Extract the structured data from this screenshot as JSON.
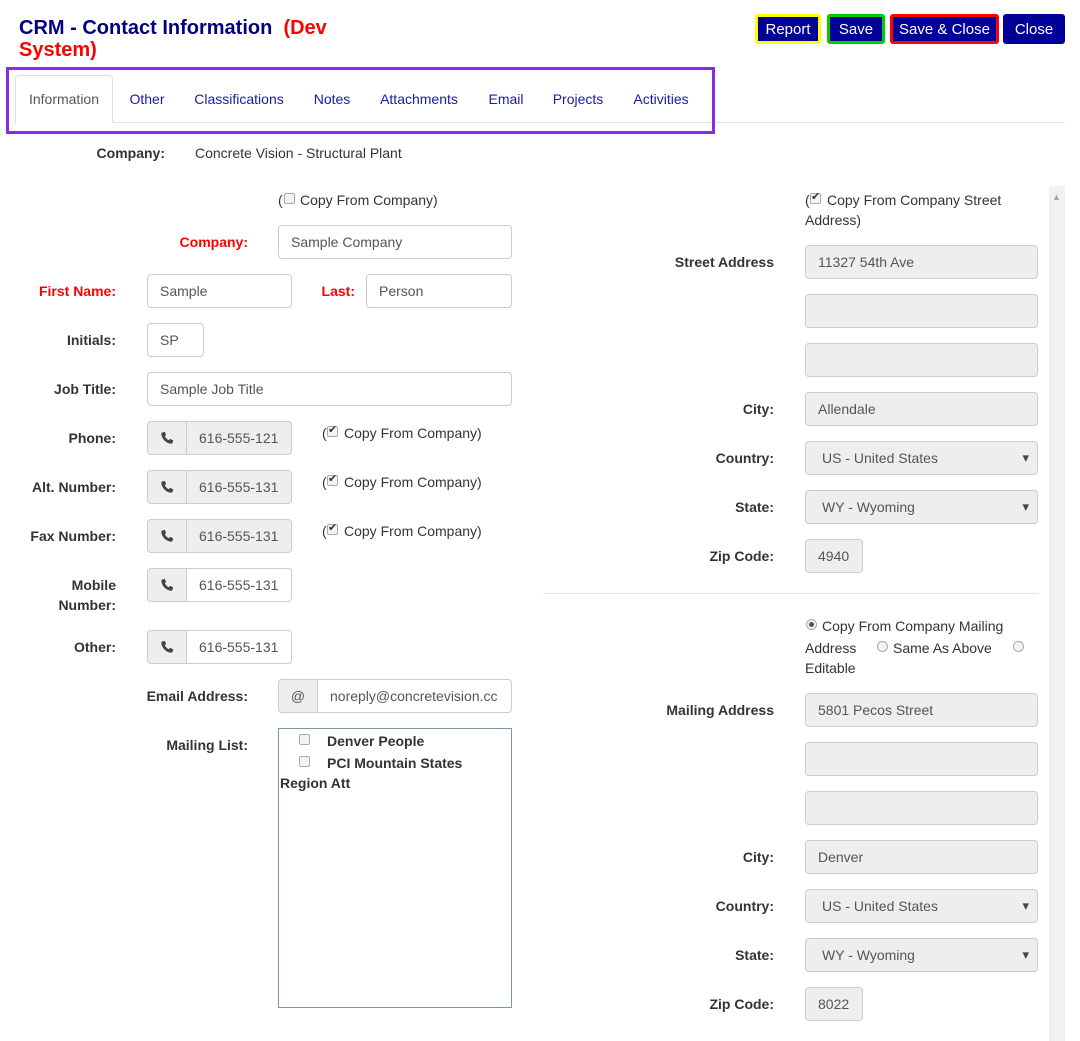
{
  "header": {
    "title": "CRM - Contact Information",
    "env": "(Dev System)"
  },
  "toolbar": {
    "report": "Report",
    "save": "Save",
    "save_close": "Save & Close",
    "close": "Close"
  },
  "tabs": [
    "Information",
    "Other",
    "Classifications",
    "Notes",
    "Attachments",
    "Email",
    "Projects",
    "Activities"
  ],
  "company_row": {
    "label": "Company:",
    "value": "Concrete Vision - Structural Plant"
  },
  "left": {
    "copy_from_company": "Copy From Company)",
    "copy_prefix": "(",
    "company_label": "Company:",
    "company_value": "Sample Company",
    "first_label": "First Name:",
    "first_value": "Sample",
    "last_label": "Last:",
    "last_value": "Person",
    "initials_label": "Initials:",
    "initials_value": "SP",
    "job_label": "Job Title:",
    "job_value": "Sample Job Title",
    "phone_label": "Phone:",
    "phone_value": "616-555-121",
    "alt_label": "Alt. Number:",
    "alt_value": "616-555-131",
    "fax_label": "Fax Number:",
    "fax_value": "616-555-131",
    "mobile_label_1": "Mobile",
    "mobile_label_2": "Number:",
    "mobile_value": "616-555-131",
    "other_label": "Other:",
    "other_value": "616-555-131",
    "copy_company": "Copy From Company)",
    "email_label": "Email Address:",
    "email_addon": "@",
    "email_value": "noreply@concretevision.cc",
    "mailing_label": "Mailing List:",
    "mailing_items": [
      "Denver People",
      "PCI Mountain States"
    ],
    "mailing_wrap": "Region Att"
  },
  "street": {
    "copy_text_1": "Copy From Company Street",
    "copy_text_2": "Address)",
    "copy_prefix": "(",
    "label": "Street Address",
    "line1": "11327 54th Ave",
    "line2": "",
    "line3": "",
    "city_label": "City:",
    "city": "Allendale",
    "country_label": "Country:",
    "country": "US - United States",
    "state_label": "State:",
    "state": "WY - Wyoming",
    "zip_label": "Zip Code:",
    "zip": "4940"
  },
  "mailing": {
    "opt_copy_1": "Copy From Company Mailing",
    "opt_copy_2": "Address",
    "opt_same": "Same As Above",
    "opt_edit": "Editable",
    "label": "Mailing Address",
    "line1": "5801 Pecos Street",
    "line2": "",
    "line3": "",
    "city_label": "City:",
    "city": "Denver",
    "country_label": "Country:",
    "country": "US - United States",
    "state_label": "State:",
    "state": "WY - Wyoming",
    "zip_label": "Zip Code:",
    "zip": "8022"
  },
  "colors": {
    "title": "#000080",
    "env": "#ff0000",
    "button_bg": "#000099",
    "tab_outline": "#8a2be2",
    "report_border": "#ffff00",
    "save_border": "#00cc00",
    "save_close_border": "#ff0000"
  }
}
